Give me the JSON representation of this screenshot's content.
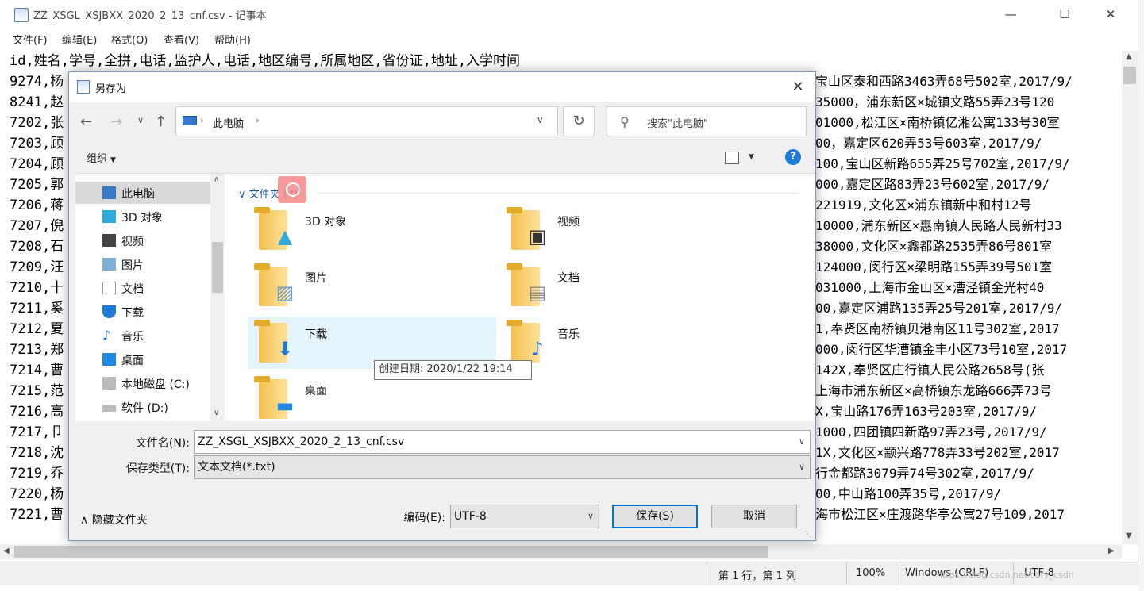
{
  "window": {
    "title": "ZZ_XSGL_XSJBXX_2020_2_13_cnf.csv - 记事本"
  },
  "menu": [
    "文件(F)",
    "编辑(E)",
    "格式(O)",
    "查看(V)",
    "帮助(H)"
  ],
  "text_lines": [
    "id,姓名,学号,全拼,电话,监护人,电话,地区编号,所属地区,省份证,地址,入学时间",
    "9274,杨",
    "8241,赵",
    "7202,张",
    "7203,顾",
    "7204,顾",
    "7205,郭",
    "7206,蒋",
    "7207,倪",
    "7208,石",
    "7209,汪",
    "7210,十",
    "7211,奚",
    "7212,夏",
    "7213,郑",
    "7214,曹",
    "7215,范",
    "7216,高",
    "7217,卩",
    "7218,沈",
    "7219,乔",
    "7220,杨",
    "7221,曹"
  ],
  "text_right": [
    "宝山区泰和西路3463弄68号502室,2017/9/",
    "35000，浦东新区×城镇文路55弄23号120",
    "01000,松江区×南桥镇亿湘公寓133号30室",
    "00，嘉定区620弄53号603室,2017/9/",
    "100,宝山区新路655弄25号702室,2017/9/",
    "000,嘉定区路83弄23号602室,2017/9/",
    "221919,文化区×浦东镇新中和村12号",
    "10000,浦东新区×惠南镇人民路人民新村33",
    "38000,文化区×鑫都路2535弄86号801室",
    "124000,闵行区×梁明路155弄39号501室",
    "031000,上海市金山区×漕泾镇金光村40",
    "00,嘉定区浦路135弄25号201室,2017/9/",
    "1,奉贤区南桥镇贝港南区11号302室,2017",
    "000,闵行区华漕镇金丰小区73号10室,2017",
    "142X,奉贤区庄行镇人民公路2658号(张",
    "上海市浦东新区×高桥镇东龙路666弄73号",
    "X,宝山路176弄163号203室,2017/9/",
    "1000,四团镇四新路97弄23号,2017/9/",
    "1X,文化区×颛兴路778弄33号202室,2017",
    "行金都路3079弄74号302室,2017/9/",
    "00,中山路100弄35号,2017/9/",
    "海市松江区×庄渡路华亭公寓27号109,2017"
  ],
  "status": {
    "position": "第 1 行，第 1 列",
    "zoom": "100%",
    "eol": "Windows (CRLF)",
    "encoding": "UTF-8"
  },
  "watermark": "https://blog.csdn.net/cary_csdn",
  "dialog": {
    "title": "另存为",
    "address": "此电脑",
    "search_placeholder": "搜索\"此电脑\"",
    "organize": "组织",
    "group_header": "文件夹 (7)",
    "nav_items": [
      "此电脑",
      "3D 对象",
      "视频",
      "图片",
      "文档",
      "下载",
      "音乐",
      "桌面",
      "本地磁盘 (C:)",
      "软件 (D:)"
    ],
    "folders": [
      "3D 对象",
      "视频",
      "图片",
      "文档",
      "下载",
      "音乐",
      "桌面"
    ],
    "tooltip": "创建日期: 2020/1/22 19:14",
    "filename_label": "文件名(N):",
    "filename_value": "ZZ_XSGL_XSJBXX_2020_2_13_cnf.csv",
    "filetype_label": "保存类型(T):",
    "filetype_value": "文本文档(*.txt)",
    "hide_folders": "隐藏文件夹",
    "encoding_label": "编码(E):",
    "encoding_value": "UTF-8",
    "save": "保存(S)",
    "cancel": "取消"
  }
}
